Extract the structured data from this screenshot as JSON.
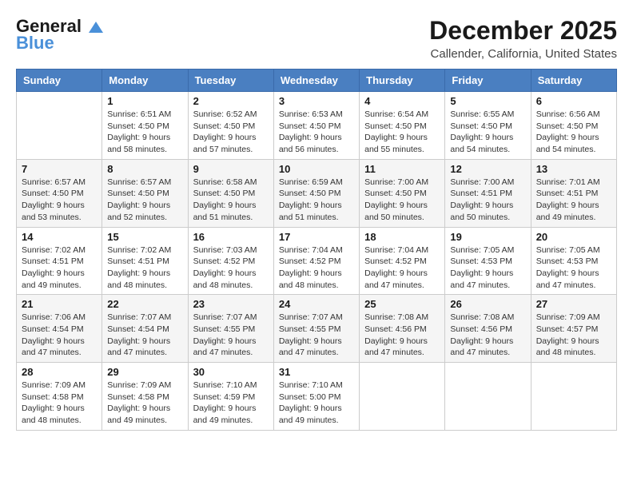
{
  "header": {
    "logo_line1": "General",
    "logo_line2": "Blue",
    "month_year": "December 2025",
    "location": "Callender, California, United States"
  },
  "columns": [
    "Sunday",
    "Monday",
    "Tuesday",
    "Wednesday",
    "Thursday",
    "Friday",
    "Saturday"
  ],
  "weeks": [
    [
      {
        "day": "",
        "sunrise": "",
        "sunset": "",
        "daylight": ""
      },
      {
        "day": "1",
        "sunrise": "6:51 AM",
        "sunset": "4:50 PM",
        "daylight": "9 hours and 58 minutes."
      },
      {
        "day": "2",
        "sunrise": "6:52 AM",
        "sunset": "4:50 PM",
        "daylight": "9 hours and 57 minutes."
      },
      {
        "day": "3",
        "sunrise": "6:53 AM",
        "sunset": "4:50 PM",
        "daylight": "9 hours and 56 minutes."
      },
      {
        "day": "4",
        "sunrise": "6:54 AM",
        "sunset": "4:50 PM",
        "daylight": "9 hours and 55 minutes."
      },
      {
        "day": "5",
        "sunrise": "6:55 AM",
        "sunset": "4:50 PM",
        "daylight": "9 hours and 54 minutes."
      },
      {
        "day": "6",
        "sunrise": "6:56 AM",
        "sunset": "4:50 PM",
        "daylight": "9 hours and 54 minutes."
      }
    ],
    [
      {
        "day": "7",
        "sunrise": "6:57 AM",
        "sunset": "4:50 PM",
        "daylight": "9 hours and 53 minutes."
      },
      {
        "day": "8",
        "sunrise": "6:57 AM",
        "sunset": "4:50 PM",
        "daylight": "9 hours and 52 minutes."
      },
      {
        "day": "9",
        "sunrise": "6:58 AM",
        "sunset": "4:50 PM",
        "daylight": "9 hours and 51 minutes."
      },
      {
        "day": "10",
        "sunrise": "6:59 AM",
        "sunset": "4:50 PM",
        "daylight": "9 hours and 51 minutes."
      },
      {
        "day": "11",
        "sunrise": "7:00 AM",
        "sunset": "4:50 PM",
        "daylight": "9 hours and 50 minutes."
      },
      {
        "day": "12",
        "sunrise": "7:00 AM",
        "sunset": "4:51 PM",
        "daylight": "9 hours and 50 minutes."
      },
      {
        "day": "13",
        "sunrise": "7:01 AM",
        "sunset": "4:51 PM",
        "daylight": "9 hours and 49 minutes."
      }
    ],
    [
      {
        "day": "14",
        "sunrise": "7:02 AM",
        "sunset": "4:51 PM",
        "daylight": "9 hours and 49 minutes."
      },
      {
        "day": "15",
        "sunrise": "7:02 AM",
        "sunset": "4:51 PM",
        "daylight": "9 hours and 48 minutes."
      },
      {
        "day": "16",
        "sunrise": "7:03 AM",
        "sunset": "4:52 PM",
        "daylight": "9 hours and 48 minutes."
      },
      {
        "day": "17",
        "sunrise": "7:04 AM",
        "sunset": "4:52 PM",
        "daylight": "9 hours and 48 minutes."
      },
      {
        "day": "18",
        "sunrise": "7:04 AM",
        "sunset": "4:52 PM",
        "daylight": "9 hours and 47 minutes."
      },
      {
        "day": "19",
        "sunrise": "7:05 AM",
        "sunset": "4:53 PM",
        "daylight": "9 hours and 47 minutes."
      },
      {
        "day": "20",
        "sunrise": "7:05 AM",
        "sunset": "4:53 PM",
        "daylight": "9 hours and 47 minutes."
      }
    ],
    [
      {
        "day": "21",
        "sunrise": "7:06 AM",
        "sunset": "4:54 PM",
        "daylight": "9 hours and 47 minutes."
      },
      {
        "day": "22",
        "sunrise": "7:07 AM",
        "sunset": "4:54 PM",
        "daylight": "9 hours and 47 minutes."
      },
      {
        "day": "23",
        "sunrise": "7:07 AM",
        "sunset": "4:55 PM",
        "daylight": "9 hours and 47 minutes."
      },
      {
        "day": "24",
        "sunrise": "7:07 AM",
        "sunset": "4:55 PM",
        "daylight": "9 hours and 47 minutes."
      },
      {
        "day": "25",
        "sunrise": "7:08 AM",
        "sunset": "4:56 PM",
        "daylight": "9 hours and 47 minutes."
      },
      {
        "day": "26",
        "sunrise": "7:08 AM",
        "sunset": "4:56 PM",
        "daylight": "9 hours and 47 minutes."
      },
      {
        "day": "27",
        "sunrise": "7:09 AM",
        "sunset": "4:57 PM",
        "daylight": "9 hours and 48 minutes."
      }
    ],
    [
      {
        "day": "28",
        "sunrise": "7:09 AM",
        "sunset": "4:58 PM",
        "daylight": "9 hours and 48 minutes."
      },
      {
        "day": "29",
        "sunrise": "7:09 AM",
        "sunset": "4:58 PM",
        "daylight": "9 hours and 49 minutes."
      },
      {
        "day": "30",
        "sunrise": "7:10 AM",
        "sunset": "4:59 PM",
        "daylight": "9 hours and 49 minutes."
      },
      {
        "day": "31",
        "sunrise": "7:10 AM",
        "sunset": "5:00 PM",
        "daylight": "9 hours and 49 minutes."
      },
      {
        "day": "",
        "sunrise": "",
        "sunset": "",
        "daylight": ""
      },
      {
        "day": "",
        "sunrise": "",
        "sunset": "",
        "daylight": ""
      },
      {
        "day": "",
        "sunrise": "",
        "sunset": "",
        "daylight": ""
      }
    ]
  ],
  "labels": {
    "sunrise_prefix": "Sunrise: ",
    "sunset_prefix": "Sunset: ",
    "daylight_prefix": "Daylight: "
  }
}
